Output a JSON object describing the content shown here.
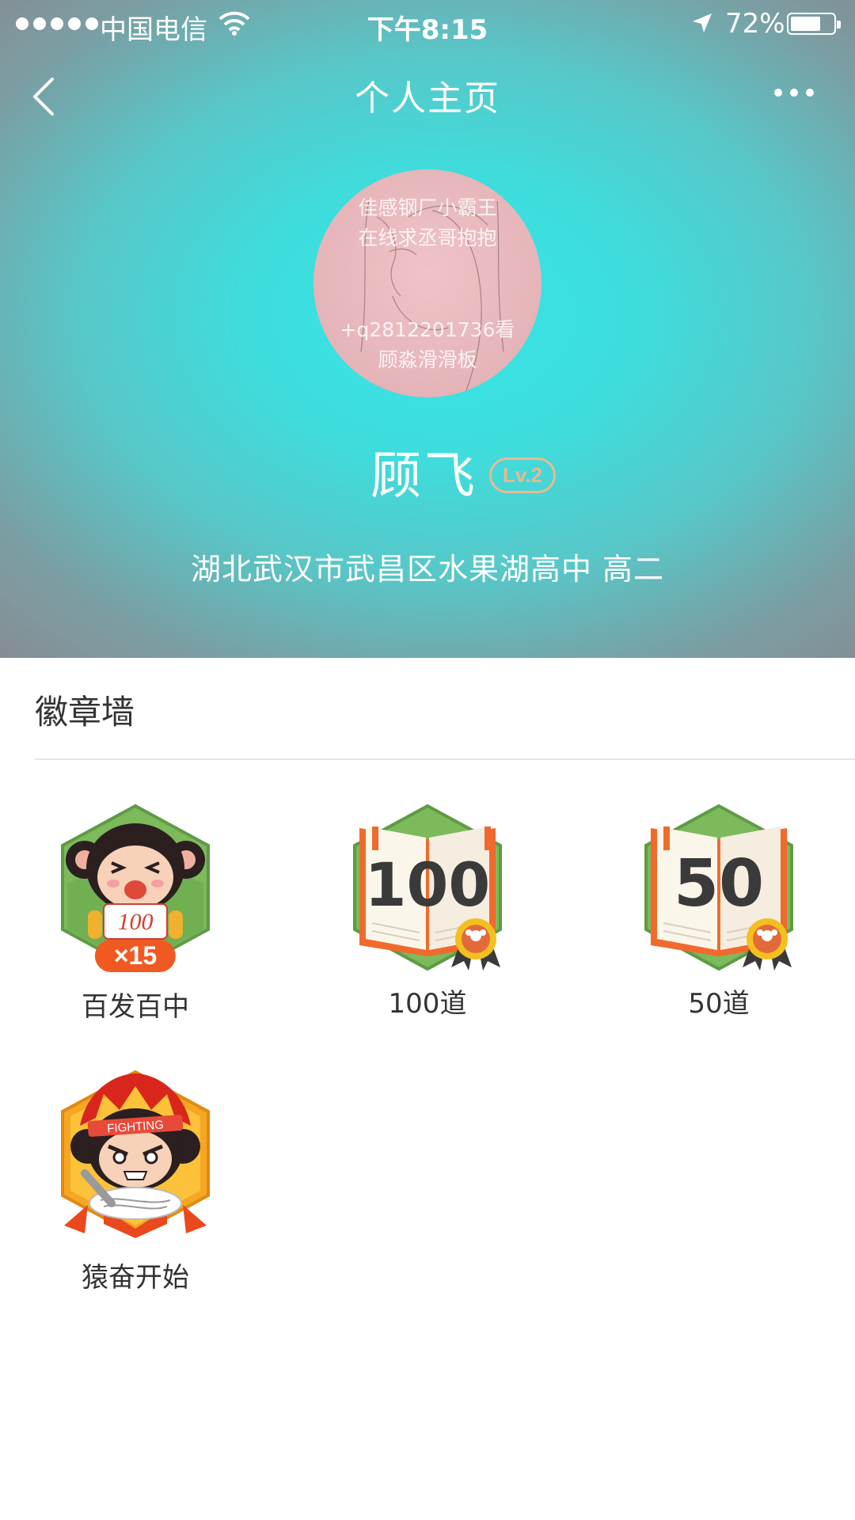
{
  "status_bar": {
    "carrier": "中国电信",
    "time": "下午8:15",
    "battery_percent_label": "72%",
    "battery_level": 0.72
  },
  "nav": {
    "title": "个人主页",
    "back_icon": "chevron-left-icon",
    "more_icon": "more-dots-icon"
  },
  "profile": {
    "avatar_text_top": [
      "佳感钢厂小霸王",
      "在线求丞哥抱抱"
    ],
    "avatar_text_bottom": [
      "+q2812201736看",
      "顾淼滑滑板"
    ],
    "name": "顾飞",
    "level": "Lv.2",
    "school": "湖北武汉市武昌区水果湖高中 高二"
  },
  "badge_wall": {
    "title": "徽章墙",
    "badges": [
      {
        "label": "百发百中",
        "count": "×15",
        "paper_text": "100",
        "icon": "monkey-100-badge-icon"
      },
      {
        "label": "100道",
        "number": "100",
        "icon": "book-100-badge-icon"
      },
      {
        "label": "50道",
        "number": "50",
        "icon": "book-50-badge-icon"
      },
      {
        "label": "猿奋开始",
        "band_text": "FIGHTING",
        "icon": "monkey-fighting-badge-icon"
      }
    ]
  },
  "colors": {
    "hero_center": "#36e6e6",
    "hex_green": "#7cba5c",
    "pill_orange": "#f05a22",
    "level_gold": "#e9b98f"
  }
}
